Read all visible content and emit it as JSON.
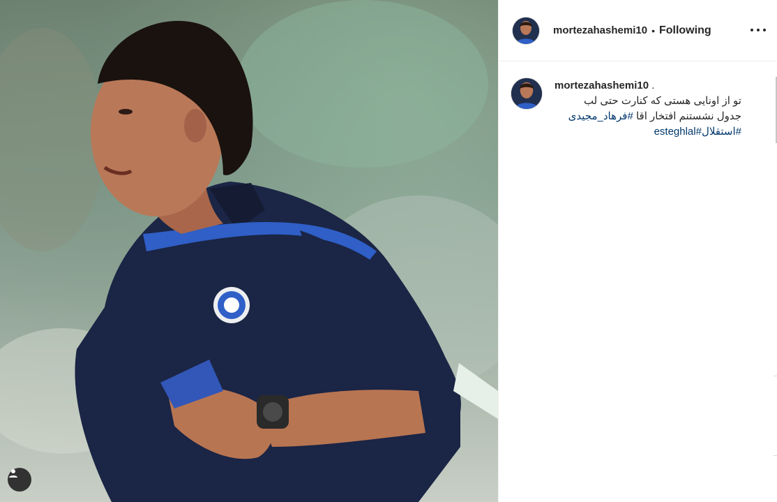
{
  "header": {
    "username": "mortezahashemi10",
    "separator": "•",
    "follow_status": "Following",
    "more_icon": "more-options-icon"
  },
  "post": {
    "media_alt": "Photo",
    "user_tag_icon": "user-tag-icon"
  },
  "caption": {
    "username": "mortezahashemi10",
    "suffix": ".",
    "line1": "تو از اونایی هستی که کنارت حتی لب",
    "line2_text": "جدول نشستنم افتخار اقا ",
    "line2_tag": "#فرهاد_مجیدی",
    "line3_tag1": "#استقلال",
    "line3_tag2": "#esteghlal"
  },
  "colors": {
    "link": "#00376b",
    "text": "#262626",
    "jersey": "#1b2545"
  }
}
